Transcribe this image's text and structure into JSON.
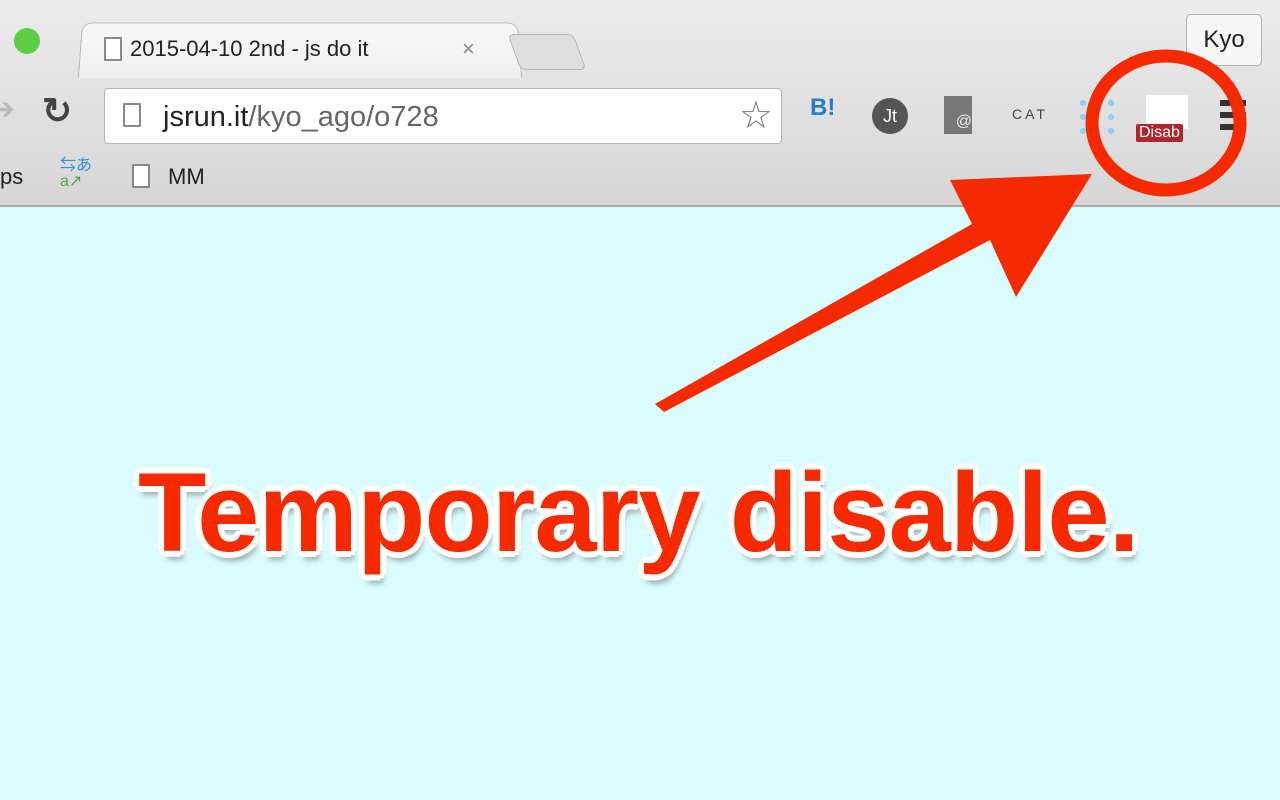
{
  "browser": {
    "tab_title": "2015-04-10 2nd - js do it",
    "tab_close": "×",
    "profile_name": "Kyo",
    "url_host": "jsrun.it",
    "url_path": "/kyo_ago/o728",
    "bookmarks": [
      {
        "label": "ps"
      },
      {
        "label": "MM"
      }
    ],
    "extensions": [
      {
        "icon": "hatena-bookmark-icon",
        "label": "B!"
      },
      {
        "icon": "jt-icon",
        "label": "Jt"
      },
      {
        "icon": "mail-at-icon",
        "label": "@"
      },
      {
        "icon": "cat-icon",
        "label": "CAT"
      },
      {
        "icon": "network-icon"
      },
      {
        "icon": "enable-right-click-icon",
        "badge": "Disab"
      }
    ]
  },
  "annotation": {
    "text": "Temporary disable.",
    "color": "#f52a00"
  },
  "page": {
    "background": "#dbfcfd"
  }
}
